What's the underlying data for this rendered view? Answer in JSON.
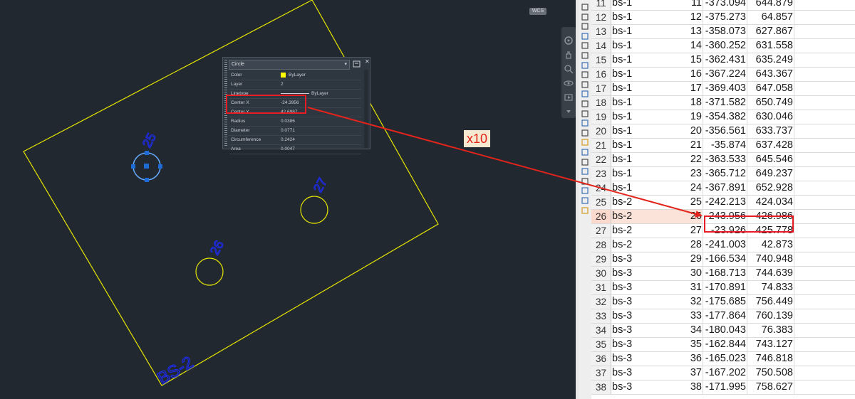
{
  "viewport": {
    "wcs_label": "WCS",
    "boundary_label": "BS-2",
    "hole_labels": [
      "25",
      "26",
      "27",
      "28"
    ],
    "colors": {
      "background": "#212830",
      "boundary": "#e6e600",
      "label": "#1e2be8",
      "selected_circle": "#66aaff",
      "grip": "#1f6bd6"
    }
  },
  "properties": {
    "object_type": "Circle",
    "rows": [
      {
        "key": "Color",
        "value": "ByLayer"
      },
      {
        "key": "Layer",
        "value": "2"
      },
      {
        "key": "Linetype",
        "value": "ByLayer"
      },
      {
        "key": "Center X",
        "value": "-24.3956"
      },
      {
        "key": "Center Y",
        "value": "42.6987"
      },
      {
        "key": "Radius",
        "value": "0.0386"
      },
      {
        "key": "Diameter",
        "value": "0.0771"
      },
      {
        "key": "Circumference",
        "value": "0.2424"
      },
      {
        "key": "Area",
        "value": "0.0047"
      }
    ]
  },
  "annotation": {
    "multiplier": "x10",
    "color": "#e3241b"
  },
  "sheet": {
    "selected_row": "26",
    "rows": [
      {
        "rn": "11",
        "a": "bs-1",
        "b": "11",
        "c": "-373.094",
        "d": "644.879"
      },
      {
        "rn": "12",
        "a": "bs-1",
        "b": "12",
        "c": "-375.273",
        "d": "64.857"
      },
      {
        "rn": "13",
        "a": "bs-1",
        "b": "13",
        "c": "-358.073",
        "d": "627.867"
      },
      {
        "rn": "14",
        "a": "bs-1",
        "b": "14",
        "c": "-360.252",
        "d": "631.558"
      },
      {
        "rn": "15",
        "a": "bs-1",
        "b": "15",
        "c": "-362.431",
        "d": "635.249"
      },
      {
        "rn": "16",
        "a": "bs-1",
        "b": "16",
        "c": "-367.224",
        "d": "643.367"
      },
      {
        "rn": "17",
        "a": "bs-1",
        "b": "17",
        "c": "-369.403",
        "d": "647.058"
      },
      {
        "rn": "18",
        "a": "bs-1",
        "b": "18",
        "c": "-371.582",
        "d": "650.749"
      },
      {
        "rn": "19",
        "a": "bs-1",
        "b": "19",
        "c": "-354.382",
        "d": "630.046"
      },
      {
        "rn": "20",
        "a": "bs-1",
        "b": "20",
        "c": "-356.561",
        "d": "633.737"
      },
      {
        "rn": "21",
        "a": "bs-1",
        "b": "21",
        "c": "-35.874",
        "d": "637.428"
      },
      {
        "rn": "22",
        "a": "bs-1",
        "b": "22",
        "c": "-363.533",
        "d": "645.546"
      },
      {
        "rn": "23",
        "a": "bs-1",
        "b": "23",
        "c": "-365.712",
        "d": "649.237"
      },
      {
        "rn": "24",
        "a": "bs-1",
        "b": "24",
        "c": "-367.891",
        "d": "652.928"
      },
      {
        "rn": "25",
        "a": "bs-2",
        "b": "25",
        "c": "-242.213",
        "d": "424.034"
      },
      {
        "rn": "26",
        "a": "bs-2",
        "b": "26",
        "c": "-243.956",
        "d": "426.986"
      },
      {
        "rn": "27",
        "a": "bs-2",
        "b": "27",
        "c": "-23.926",
        "d": "425.778"
      },
      {
        "rn": "28",
        "a": "bs-2",
        "b": "28",
        "c": "-241.003",
        "d": "42.873"
      },
      {
        "rn": "29",
        "a": "bs-3",
        "b": "29",
        "c": "-166.534",
        "d": "740.948"
      },
      {
        "rn": "30",
        "a": "bs-3",
        "b": "30",
        "c": "-168.713",
        "d": "744.639"
      },
      {
        "rn": "31",
        "a": "bs-3",
        "b": "31",
        "c": "-170.891",
        "d": "74.833"
      },
      {
        "rn": "32",
        "a": "bs-3",
        "b": "32",
        "c": "-175.685",
        "d": "756.449"
      },
      {
        "rn": "33",
        "a": "bs-3",
        "b": "33",
        "c": "-177.864",
        "d": "760.139"
      },
      {
        "rn": "34",
        "a": "bs-3",
        "b": "34",
        "c": "-180.043",
        "d": "76.383"
      },
      {
        "rn": "35",
        "a": "bs-3",
        "b": "35",
        "c": "-162.844",
        "d": "743.127"
      },
      {
        "rn": "36",
        "a": "bs-3",
        "b": "36",
        "c": "-165.023",
        "d": "746.818"
      },
      {
        "rn": "37",
        "a": "bs-3",
        "b": "37",
        "c": "-167.202",
        "d": "750.508"
      },
      {
        "rn": "38",
        "a": "bs-3",
        "b": "38",
        "c": "-171.995",
        "d": "758.627"
      }
    ]
  }
}
